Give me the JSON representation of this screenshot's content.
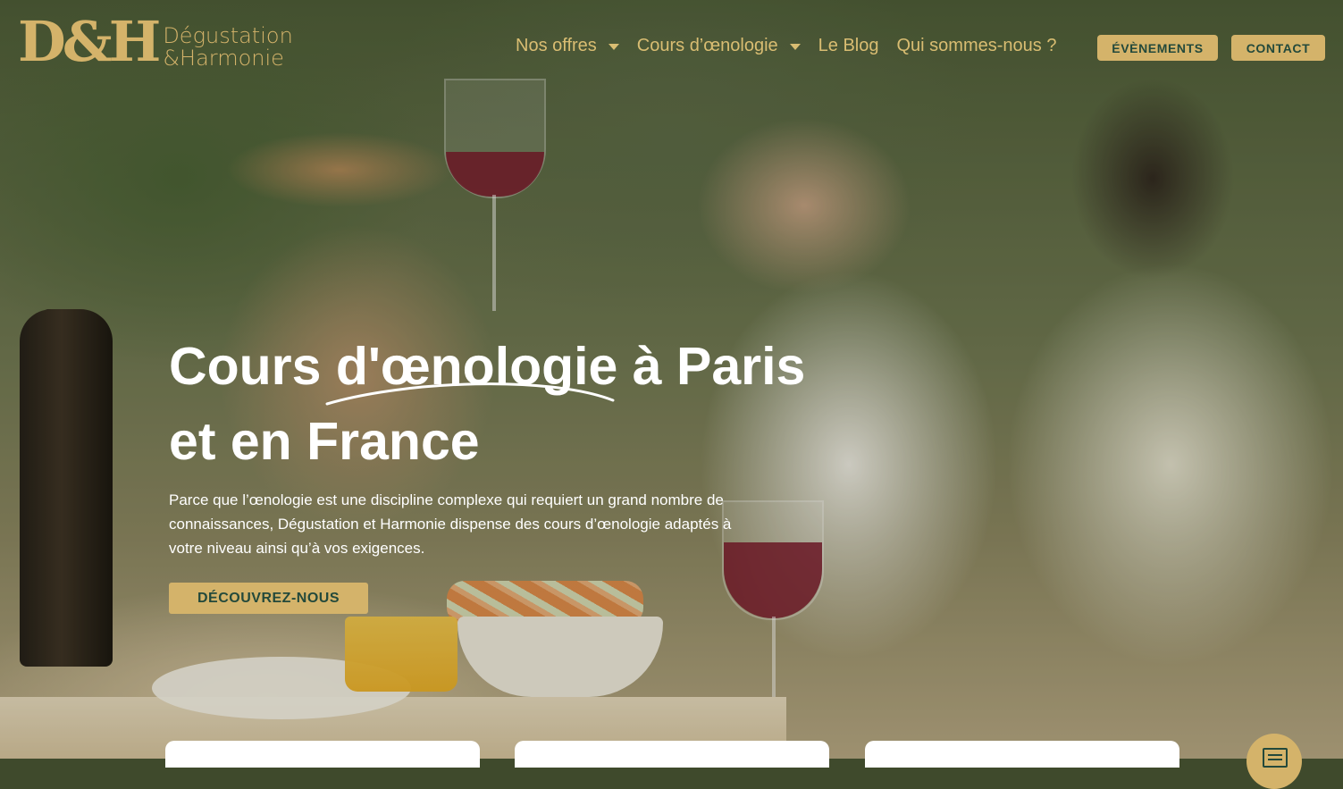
{
  "brand": {
    "logo_mark": "D&H",
    "logo_line1": "Dégustation",
    "logo_line2": "&Harmonie",
    "accent_color": "#d4b36a",
    "dark_green": "#23493b"
  },
  "nav": {
    "items": [
      {
        "label": "Nos offres",
        "has_dropdown": true
      },
      {
        "label": "Cours d’œnologie",
        "has_dropdown": true
      },
      {
        "label": "Le Blog",
        "has_dropdown": false
      },
      {
        "label": "Qui sommes-nous ?",
        "has_dropdown": false
      }
    ],
    "events_button": "ÉVÈNEMENTS",
    "contact_button": "CONTACT"
  },
  "hero": {
    "title_line1": "Cours d'œnologie à Paris",
    "title_line2": "et en France",
    "description": "Parce que l’œnologie est une discipline complexe qui requiert un grand nombre de connaissances, Dégustation et Harmonie dispense des cours d’œnologie adaptés à votre niveau ainsi qu’à vos exigences.",
    "cta_label": "DÉCOUVREZ-NOUS"
  },
  "chat": {
    "icon": "chat-icon"
  }
}
